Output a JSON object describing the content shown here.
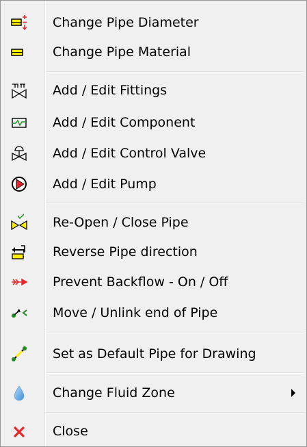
{
  "menu": {
    "items": [
      {
        "label": "Change Pipe Diameter",
        "icon": "pipe-diameter-icon"
      },
      {
        "label": "Change Pipe Material",
        "icon": "pipe-material-icon"
      },
      {
        "label": "Add / Edit Fittings",
        "icon": "fittings-icon"
      },
      {
        "label": "Add / Edit Component",
        "icon": "component-icon"
      },
      {
        "label": "Add / Edit Control Valve",
        "icon": "control-valve-icon"
      },
      {
        "label": "Add / Edit Pump",
        "icon": "pump-icon"
      },
      {
        "label": "Re-Open / Close Pipe",
        "icon": "open-close-pipe-icon"
      },
      {
        "label": "Reverse Pipe direction",
        "icon": "reverse-direction-icon"
      },
      {
        "label": "Prevent Backflow - On / Off",
        "icon": "backflow-icon"
      },
      {
        "label": "Move / Unlink end of Pipe",
        "icon": "unlink-icon"
      },
      {
        "label": "Set as Default Pipe for Drawing",
        "icon": "default-pipe-icon"
      },
      {
        "label": "Change Fluid Zone",
        "icon": "fluid-zone-icon",
        "has_submenu": true
      },
      {
        "label": "Close",
        "icon": "close-icon"
      }
    ]
  },
  "colors": {
    "menu_bg": "#f0f0f0",
    "pipe_yellow": "#ffee00",
    "accent_red": "#e8262a",
    "accent_green": "#1c8a1c",
    "drop_blue": "#5aa8e6"
  }
}
